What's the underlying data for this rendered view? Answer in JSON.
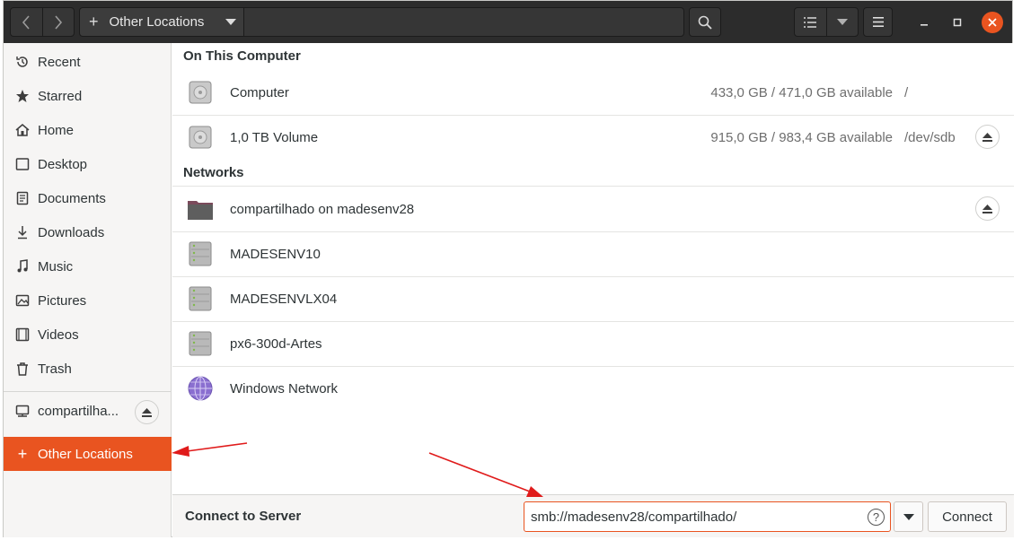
{
  "colors": {
    "accent": "#e95420",
    "headerbar": "#2c2c2c",
    "sidebar_bg": "#f6f5f4",
    "annotation_arrow": "#e01b1b"
  },
  "headerbar": {
    "back_icon": "chevron-left-icon",
    "forward_icon": "chevron-right-icon",
    "location_label": "Other Locations",
    "location_icon": "plus-icon",
    "search_icon": "search-icon",
    "view_icon": "list-view-icon",
    "menu_icon": "hamburger-menu-icon"
  },
  "sidebar": {
    "items": [
      {
        "label": "Recent",
        "icon": "clock-icon"
      },
      {
        "label": "Starred",
        "icon": "star-icon"
      },
      {
        "label": "Home",
        "icon": "home-icon"
      },
      {
        "label": "Desktop",
        "icon": "desktop-icon"
      },
      {
        "label": "Documents",
        "icon": "document-icon"
      },
      {
        "label": "Downloads",
        "icon": "download-icon"
      },
      {
        "label": "Music",
        "icon": "music-icon"
      },
      {
        "label": "Pictures",
        "icon": "picture-icon"
      },
      {
        "label": "Videos",
        "icon": "video-icon"
      },
      {
        "label": "Trash",
        "icon": "trash-icon"
      }
    ],
    "mount": {
      "label": "compartilha...",
      "icon": "network-folder-icon"
    },
    "active": {
      "label": "Other Locations",
      "icon": "plus-icon"
    }
  },
  "main": {
    "on_this_computer": {
      "heading": "On This Computer",
      "rows": [
        {
          "name": "Computer",
          "size": "433,0 GB / 471,0 GB available",
          "path": "/"
        },
        {
          "name": "1,0 TB Volume",
          "size": "915,0 GB / 983,4 GB available",
          "path": "/dev/sdb"
        }
      ]
    },
    "networks": {
      "heading": "Networks",
      "rows": [
        {
          "name": "compartilhado on madesenv28",
          "icon": "folder-icon"
        },
        {
          "name": "MADESENV10",
          "icon": "server-icon"
        },
        {
          "name": "MADESENVLX04",
          "icon": "server-icon"
        },
        {
          "name": "px6-300d-Artes",
          "icon": "server-icon"
        },
        {
          "name": "Windows Network",
          "icon": "globe-icon"
        }
      ]
    }
  },
  "footer": {
    "label": "Connect to Server",
    "server_value": "smb://madesenv28/compartilhado/",
    "help_glyph": "?",
    "connect_label": "Connect"
  }
}
